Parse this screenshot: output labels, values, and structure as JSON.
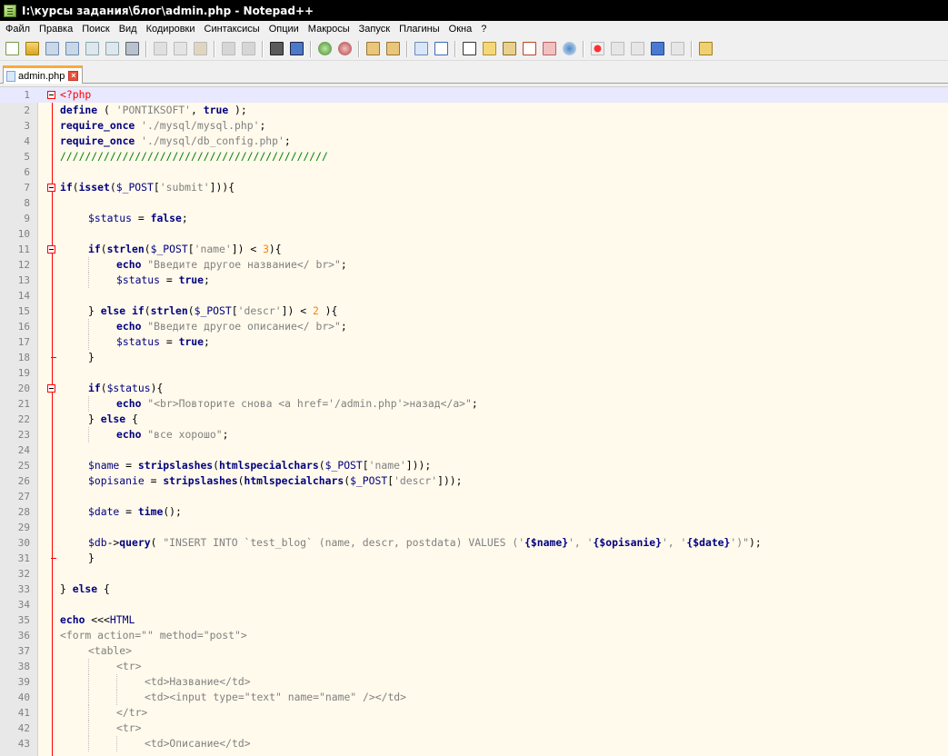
{
  "window": {
    "title": "I:\\курсы задания\\блог\\admin.php - Notepad++"
  },
  "menu": [
    "Файл",
    "Правка",
    "Поиск",
    "Вид",
    "Кодировки",
    "Синтаксисы",
    "Опции",
    "Макросы",
    "Запуск",
    "Плагины",
    "Окна",
    "?"
  ],
  "toolbar": {
    "groups": [
      [
        "new-file-icon",
        "open-file-icon",
        "save-icon",
        "save-all-icon",
        "close-icon",
        "close-all-icon",
        "print-icon"
      ],
      [
        "cut-icon",
        "copy-icon",
        "paste-icon"
      ],
      [
        "undo-icon",
        "redo-icon"
      ],
      [
        "find-icon",
        "replace-icon"
      ],
      [
        "zoom-in-icon",
        "zoom-out-icon"
      ],
      [
        "sync-vertical-icon",
        "sync-horizontal-icon"
      ],
      [
        "word-wrap-icon",
        "show-all-chars-icon"
      ],
      [
        "indent-guide-icon",
        "user-defined-lang-icon",
        "doc-map-icon",
        "function-list-icon",
        "folder-as-workspace-icon",
        "monitoring-icon"
      ],
      [
        "record-macro-icon",
        "stop-macro-icon",
        "play-macro-icon",
        "run-macro-multiple-icon",
        "save-macro-icon"
      ],
      [
        "open-in-explorer-icon"
      ]
    ]
  },
  "tab": {
    "label": "admin.php",
    "close": "×"
  },
  "editor": {
    "lines": [
      {
        "n": "1",
        "fold": "open",
        "active": true,
        "tokens": [
          [
            "ph",
            "<?php"
          ]
        ]
      },
      {
        "n": "2",
        "tokens": [
          [
            "k",
            "define"
          ],
          [
            "p",
            " ( "
          ],
          [
            "s",
            "'PONTIKSOFT'"
          ],
          [
            "p",
            ", "
          ],
          [
            "k",
            "true"
          ],
          [
            "p",
            " );"
          ]
        ]
      },
      {
        "n": "3",
        "tokens": [
          [
            "k",
            "require_once"
          ],
          [
            "p",
            " "
          ],
          [
            "s",
            "'./mysql/mysql.php'"
          ],
          [
            "p",
            ";"
          ]
        ]
      },
      {
        "n": "4",
        "tokens": [
          [
            "k",
            "require_once"
          ],
          [
            "p",
            " "
          ],
          [
            "s",
            "'./mysql/db_config.php'"
          ],
          [
            "p",
            ";"
          ]
        ]
      },
      {
        "n": "5",
        "tokens": [
          [
            "c",
            "///////////////////////////////////////////"
          ]
        ]
      },
      {
        "n": "6",
        "tokens": []
      },
      {
        "n": "7",
        "fold": "open",
        "tokens": [
          [
            "k",
            "if"
          ],
          [
            "p",
            "("
          ],
          [
            "k",
            "isset"
          ],
          [
            "p",
            "("
          ],
          [
            "v",
            "$_POST"
          ],
          [
            "p",
            "["
          ],
          [
            "s",
            "'submit'"
          ],
          [
            "p",
            "])){"
          ]
        ]
      },
      {
        "n": "8",
        "tokens": []
      },
      {
        "n": "9",
        "indent": 1,
        "tokens": [
          [
            "v",
            "$status"
          ],
          [
            "p",
            " = "
          ],
          [
            "k",
            "false"
          ],
          [
            "p",
            ";"
          ]
        ]
      },
      {
        "n": "10",
        "tokens": []
      },
      {
        "n": "11",
        "indent": 1,
        "fold": "open",
        "tokens": [
          [
            "k",
            "if"
          ],
          [
            "p",
            "("
          ],
          [
            "k",
            "strlen"
          ],
          [
            "p",
            "("
          ],
          [
            "v",
            "$_POST"
          ],
          [
            "p",
            "["
          ],
          [
            "s",
            "'name'"
          ],
          [
            "p",
            "]) < "
          ],
          [
            "n",
            "3"
          ],
          [
            "p",
            "){"
          ]
        ]
      },
      {
        "n": "12",
        "indent": 2,
        "tokens": [
          [
            "k",
            "echo"
          ],
          [
            "p",
            " "
          ],
          [
            "s",
            "\"Введите другое название</ br>\""
          ],
          [
            "p",
            ";"
          ]
        ]
      },
      {
        "n": "13",
        "indent": 2,
        "tokens": [
          [
            "v",
            "$status"
          ],
          [
            "p",
            " = "
          ],
          [
            "k",
            "true"
          ],
          [
            "p",
            ";"
          ]
        ]
      },
      {
        "n": "14",
        "tokens": []
      },
      {
        "n": "15",
        "indent": 1,
        "tokens": [
          [
            "p",
            "} "
          ],
          [
            "k",
            "else if"
          ],
          [
            "p",
            "("
          ],
          [
            "k",
            "strlen"
          ],
          [
            "p",
            "("
          ],
          [
            "v",
            "$_POST"
          ],
          [
            "p",
            "["
          ],
          [
            "s",
            "'descr'"
          ],
          [
            "p",
            "]) < "
          ],
          [
            "n",
            "2"
          ],
          [
            "p",
            " ){"
          ]
        ]
      },
      {
        "n": "16",
        "indent": 2,
        "tokens": [
          [
            "k",
            "echo"
          ],
          [
            "p",
            " "
          ],
          [
            "s",
            "\"Введите другое описание</ br>\""
          ],
          [
            "p",
            ";"
          ]
        ]
      },
      {
        "n": "17",
        "indent": 2,
        "tokens": [
          [
            "v",
            "$status"
          ],
          [
            "p",
            " = "
          ],
          [
            "k",
            "true"
          ],
          [
            "p",
            ";"
          ]
        ]
      },
      {
        "n": "18",
        "indent": 1,
        "fold": "end",
        "tokens": [
          [
            "p",
            "}"
          ]
        ]
      },
      {
        "n": "19",
        "tokens": []
      },
      {
        "n": "20",
        "indent": 1,
        "fold": "open",
        "tokens": [
          [
            "k",
            "if"
          ],
          [
            "p",
            "("
          ],
          [
            "v",
            "$status"
          ],
          [
            "p",
            "){"
          ]
        ]
      },
      {
        "n": "21",
        "indent": 2,
        "tokens": [
          [
            "k",
            "echo"
          ],
          [
            "p",
            " "
          ],
          [
            "s",
            "\"<br>Повторите снова <a href='/admin.php'>назад</a>\""
          ],
          [
            "p",
            ";"
          ]
        ]
      },
      {
        "n": "22",
        "indent": 1,
        "tokens": [
          [
            "p",
            "} "
          ],
          [
            "k",
            "else"
          ],
          [
            "p",
            " {"
          ]
        ]
      },
      {
        "n": "23",
        "indent": 2,
        "tokens": [
          [
            "k",
            "echo"
          ],
          [
            "p",
            " "
          ],
          [
            "s",
            "\"все хорошо\""
          ],
          [
            "p",
            ";"
          ]
        ]
      },
      {
        "n": "24",
        "tokens": []
      },
      {
        "n": "25",
        "indent": 1,
        "tokens": [
          [
            "v",
            "$name"
          ],
          [
            "p",
            " = "
          ],
          [
            "k",
            "stripslashes"
          ],
          [
            "p",
            "("
          ],
          [
            "k",
            "htmlspecialchars"
          ],
          [
            "p",
            "("
          ],
          [
            "v",
            "$_POST"
          ],
          [
            "p",
            "["
          ],
          [
            "s",
            "'name'"
          ],
          [
            "p",
            "]));"
          ]
        ]
      },
      {
        "n": "26",
        "indent": 1,
        "tokens": [
          [
            "v",
            "$opisanie"
          ],
          [
            "p",
            " = "
          ],
          [
            "k",
            "stripslashes"
          ],
          [
            "p",
            "("
          ],
          [
            "k",
            "htmlspecialchars"
          ],
          [
            "p",
            "("
          ],
          [
            "v",
            "$_POST"
          ],
          [
            "p",
            "["
          ],
          [
            "s",
            "'descr'"
          ],
          [
            "p",
            "]));"
          ]
        ]
      },
      {
        "n": "27",
        "tokens": []
      },
      {
        "n": "28",
        "indent": 1,
        "tokens": [
          [
            "v",
            "$date"
          ],
          [
            "p",
            " = "
          ],
          [
            "k",
            "time"
          ],
          [
            "p",
            "();"
          ]
        ]
      },
      {
        "n": "29",
        "tokens": []
      },
      {
        "n": "30",
        "indent": 1,
        "tokens": [
          [
            "v",
            "$db"
          ],
          [
            "p",
            "->"
          ],
          [
            "k",
            "query"
          ],
          [
            "p",
            "( "
          ],
          [
            "s",
            "\"INSERT INTO `test_blog` (name, descr, postdata) VALUES ('"
          ],
          [
            "k",
            "{$name}"
          ],
          [
            "s",
            "', '"
          ],
          [
            "k",
            "{$opisanie}"
          ],
          [
            "s",
            "', '"
          ],
          [
            "k",
            "{$date}"
          ],
          [
            "s",
            "')\""
          ],
          [
            "p",
            ");"
          ]
        ]
      },
      {
        "n": "31",
        "indent": 1,
        "fold": "end",
        "tokens": [
          [
            "p",
            "}"
          ]
        ]
      },
      {
        "n": "32",
        "tokens": []
      },
      {
        "n": "33",
        "tokens": [
          [
            "p",
            "} "
          ],
          [
            "k",
            "else"
          ],
          [
            "p",
            " {"
          ]
        ]
      },
      {
        "n": "34",
        "tokens": []
      },
      {
        "n": "35",
        "tokens": [
          [
            "k",
            "echo"
          ],
          [
            "p",
            " <<<"
          ],
          [
            "h",
            "HTML"
          ]
        ]
      },
      {
        "n": "36",
        "tokens": [
          [
            "s",
            "<form action=\"\" method=\"post\">"
          ]
        ]
      },
      {
        "n": "37",
        "indent": 1,
        "tokens": [
          [
            "s",
            "<table>"
          ]
        ]
      },
      {
        "n": "38",
        "indent": 2,
        "tokens": [
          [
            "s",
            "<tr>"
          ]
        ]
      },
      {
        "n": "39",
        "indent": 3,
        "tokens": [
          [
            "s",
            "<td>Название</td>"
          ]
        ]
      },
      {
        "n": "40",
        "indent": 3,
        "tokens": [
          [
            "s",
            "<td><input type=\"text\" name=\"name\" /></td>"
          ]
        ]
      },
      {
        "n": "41",
        "indent": 2,
        "tokens": [
          [
            "s",
            "</tr>"
          ]
        ]
      },
      {
        "n": "42",
        "indent": 2,
        "tokens": [
          [
            "s",
            "<tr>"
          ]
        ]
      },
      {
        "n": "43",
        "indent": 3,
        "tokens": [
          [
            "s",
            "<td>Описание</td>"
          ]
        ]
      }
    ]
  },
  "colors": {
    "editor_background": "#fffaec",
    "active_line": "#e8e8ff",
    "keyword": "#000080",
    "string": "#808080",
    "number": "#ff8000",
    "comment": "#008000",
    "php_tag": "#ff0000",
    "tab_accent": "#faaa3c"
  }
}
